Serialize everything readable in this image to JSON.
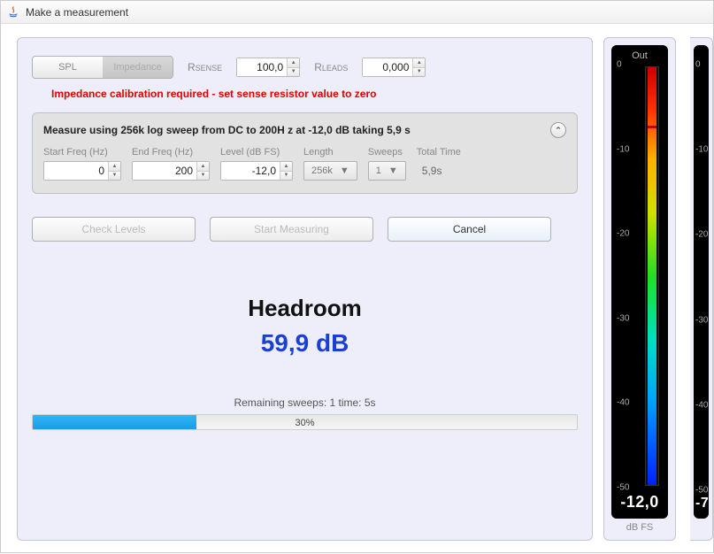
{
  "window": {
    "title": "Make a measurement"
  },
  "segmented": {
    "spl": "SPL",
    "impedance": "Impedance"
  },
  "sense": {
    "prefix": "R",
    "sub": "SENSE",
    "value": "100,0"
  },
  "leads": {
    "prefix": "R",
    "sub": "LEADS",
    "value": "0,000"
  },
  "warning": "Impedance calibration required - set sense resistor value to zero",
  "sweepHeader": "Measure using  256k log sweep from DC to 200H z at -12,0 dB taking 5,9 s",
  "fields": {
    "startFreq": {
      "label": "Start Freq (Hz)",
      "value": "0"
    },
    "endFreq": {
      "label": "End Freq (Hz)",
      "value": "200"
    },
    "level": {
      "label": "Level (dB FS)",
      "value": "-12,0"
    },
    "length": {
      "label": "Length",
      "value": "256k"
    },
    "sweeps": {
      "label": "Sweeps",
      "value": "1"
    },
    "totalTime": {
      "label": "Total Time",
      "value": "5,9s"
    }
  },
  "buttons": {
    "checkLevels": "Check Levels",
    "startMeasuring": "Start Measuring",
    "cancel": "Cancel"
  },
  "headroom": {
    "title": "Headroom",
    "value": "59,9 dB"
  },
  "status": "Remaining sweeps: 1   time: 5s",
  "progress": {
    "percent": 30,
    "text": "30%"
  },
  "meter": {
    "out": {
      "title": "Out",
      "value": "-12,0",
      "unit": "dB FS",
      "ticks": [
        "0",
        "-10",
        "-20",
        "-30",
        "-40",
        "-50"
      ],
      "peakPct": 14
    },
    "other": {
      "value": "-7",
      "ticks": [
        "0",
        "-10",
        "-20",
        "-30",
        "-40",
        "-50"
      ]
    }
  }
}
